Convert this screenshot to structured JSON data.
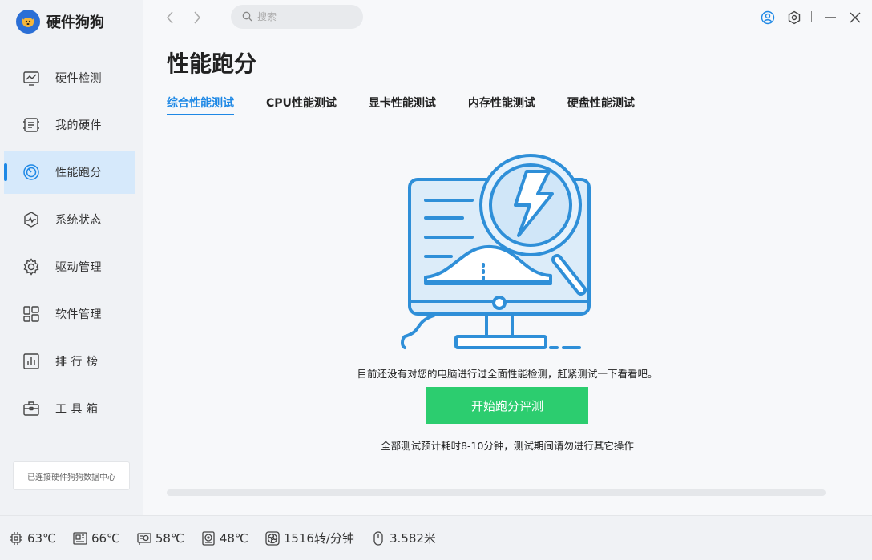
{
  "app": {
    "name": "硬件狗狗"
  },
  "sidebar": {
    "items": [
      {
        "label": "硬件检测",
        "icon": "monitor-chart-icon"
      },
      {
        "label": "我的硬件",
        "icon": "hardware-board-icon"
      },
      {
        "label": "性能跑分",
        "icon": "speedometer-icon",
        "active": true
      },
      {
        "label": "系统状态",
        "icon": "system-status-icon"
      },
      {
        "label": "驱动管理",
        "icon": "gear-icon"
      },
      {
        "label": "软件管理",
        "icon": "apps-grid-icon"
      },
      {
        "label": "排 行 榜",
        "icon": "ranking-chart-icon"
      },
      {
        "label": "工 具 箱",
        "icon": "toolbox-icon"
      }
    ],
    "status": "已连接硬件狗狗数据中心"
  },
  "topbar": {
    "search_placeholder": "搜索",
    "icons": [
      "back-arrow-icon",
      "forward-arrow-icon",
      "user-icon",
      "settings-icon",
      "minimize-icon",
      "close-icon"
    ]
  },
  "main": {
    "title": "性能跑分",
    "tabs": [
      {
        "label": "综合性能测试",
        "active": true
      },
      {
        "label": "CPU性能测试"
      },
      {
        "label": "显卡性能测试"
      },
      {
        "label": "内存性能测试"
      },
      {
        "label": "硬盘性能测试"
      }
    ],
    "description": "目前还没有对您的电脑进行过全面性能检测，赶紧测试一下看看吧。",
    "start_button": "开始跑分评测",
    "note": "全部测试预计耗时8-10分钟，测试期间请勿进行其它操作"
  },
  "footer": {
    "items": [
      {
        "icon": "cpu-icon",
        "value": "63℃"
      },
      {
        "icon": "motherboard-icon",
        "value": "66℃"
      },
      {
        "icon": "gpu-icon",
        "value": "58℃"
      },
      {
        "icon": "disk-icon",
        "value": "48℃"
      },
      {
        "icon": "fan-icon",
        "value": "1516转/分钟"
      },
      {
        "icon": "mouse-icon",
        "value": "3.582米"
      }
    ]
  },
  "colors": {
    "accent": "#1e88e5",
    "button": "#2ccd6f",
    "illustration": "#2f8fd8"
  }
}
